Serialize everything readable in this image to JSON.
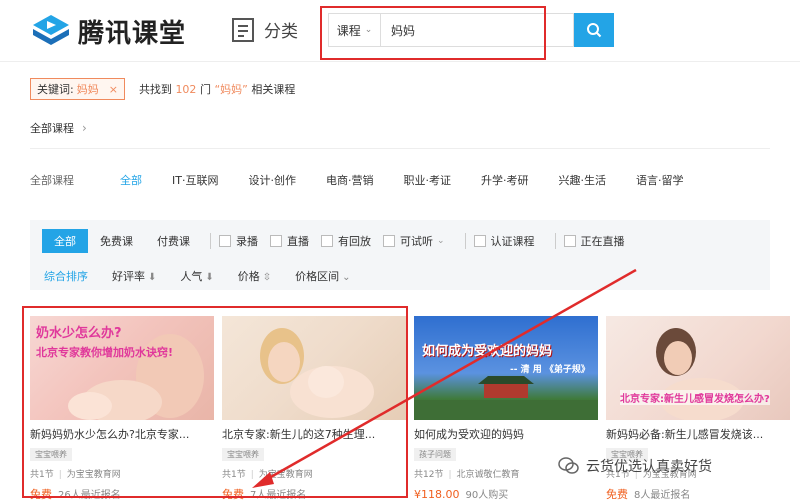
{
  "header": {
    "brand": "腾讯课堂",
    "category_label": "分类",
    "search": {
      "type": "课程",
      "value": "妈妈"
    }
  },
  "keyword": {
    "label": "关键词:",
    "value": "妈妈",
    "found_pre": "共找到",
    "count": "102",
    "found_unit": "门",
    "query": "“妈妈”",
    "found_post": "相关课程"
  },
  "breadcrumb": {
    "label": "全部课程"
  },
  "categories": {
    "label": "全部课程",
    "items": [
      "全部",
      "IT·互联网",
      "设计·创作",
      "电商·营销",
      "职业·考证",
      "升学·考研",
      "兴趣·生活",
      "语言·留学"
    ]
  },
  "filters": {
    "pills": [
      "全部",
      "免费课",
      "付费课"
    ],
    "checkboxes": [
      "录播",
      "直播",
      "有回放",
      "可试听",
      "认证课程",
      "正在直播"
    ],
    "sorts": [
      "综合排序",
      "好评率",
      "人气",
      "价格",
      "价格区间"
    ]
  },
  "cards": [
    {
      "thumb_caption_1": "奶水少怎么办?",
      "thumb_caption_2": "北京专家教你增加奶水诀窍!",
      "title": "新妈妈奶水少怎么办?北京专家...",
      "tag": "宝宝喂养",
      "lessons": "共1节",
      "org": "为宝宝教育网",
      "price": "免费",
      "signups": "26人最近报名"
    },
    {
      "title": "北京专家:新生儿的这7种生理...",
      "tag": "宝宝喂养",
      "lessons": "共1节",
      "org": "为宝宝教育网",
      "price": "免费",
      "signups": "7人最近报名"
    },
    {
      "thumb_caption_1": "如何成为受欢迎的妈妈",
      "thumb_caption_2": "-- 清 用 《弟子规》",
      "title": "如何成为受欢迎的妈妈",
      "tag": "孩子问题",
      "lessons": "共12节",
      "org": "北京诚敬仁教育",
      "price": "¥118.00",
      "signups": "90人购买"
    },
    {
      "thumb_caption_1": "北京专家:新生儿感冒发烧怎么办?",
      "title": "新妈妈必备:新生儿感冒发烧该...",
      "tag": "宝宝喂养",
      "lessons": "共1节",
      "org": "为宝宝教育网",
      "price": "免费",
      "signups": "8人最近报名"
    }
  ],
  "watermark": {
    "text": "云货优选认真卖好货"
  },
  "colors": {
    "accent": "#23a4e6",
    "price": "#f06020",
    "annotation": "#e02b2b"
  }
}
